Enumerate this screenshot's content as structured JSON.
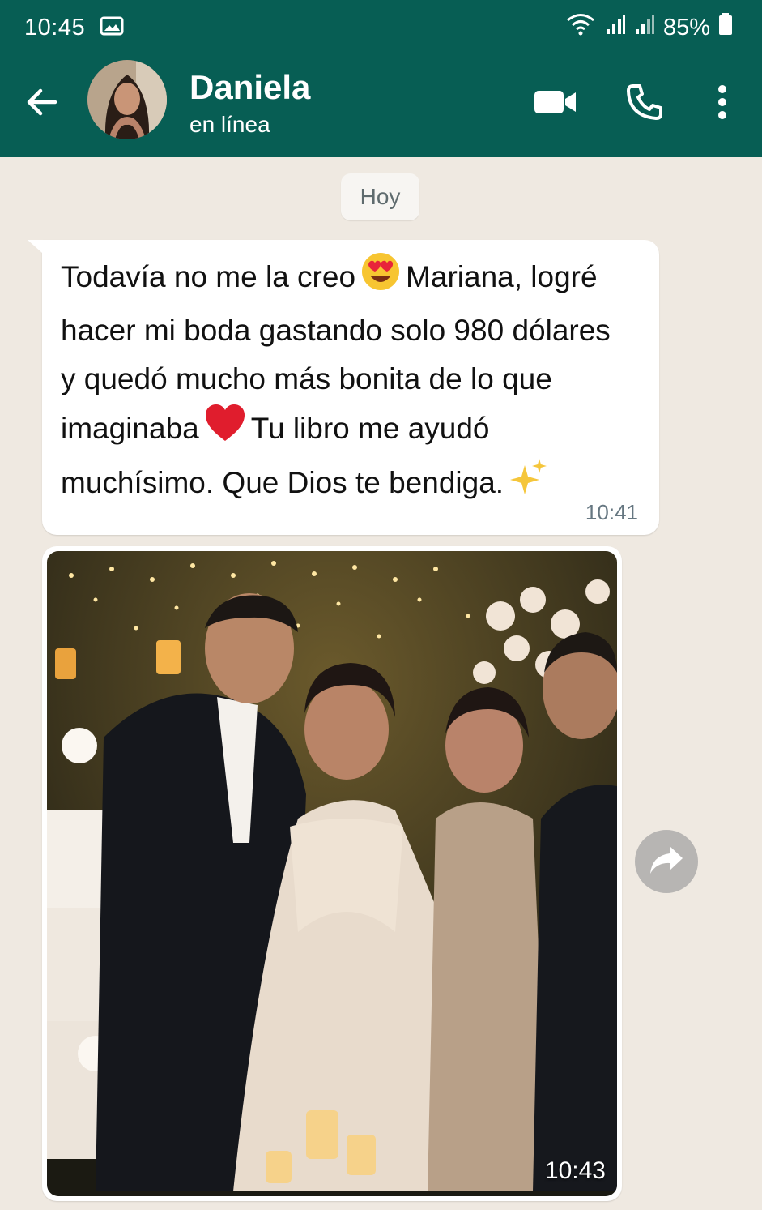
{
  "status_bar": {
    "time": "10:45",
    "battery": "85%"
  },
  "header": {
    "name": "Daniela",
    "status": "en línea"
  },
  "chat": {
    "date_label": "Hoy",
    "message": {
      "line1_a": "Todavía no me la creo",
      "line1_b": "Mariana, logré",
      "line2": "hacer mi boda gastando solo 980 dólares",
      "line3": "y quedó mucho más bonita de lo que",
      "line4_a": "imaginaba",
      "line4_b": "Tu libro me ayudó",
      "line5": "muchísimo. Que Dios te bendiga.",
      "time": "10:41"
    },
    "image_message": {
      "time": "10:43"
    }
  },
  "colors": {
    "header": "#075e54",
    "chat_bg": "#efe9e1",
    "bubble": "#ffffff"
  },
  "icons": [
    "gallery-icon",
    "wifi-icon",
    "signal-icon",
    "battery-icon",
    "back-arrow-icon",
    "video-call-icon",
    "phone-icon",
    "more-options-icon",
    "heart-eyes-emoji",
    "red-heart-emoji",
    "sparkles-emoji",
    "forward-icon"
  ]
}
